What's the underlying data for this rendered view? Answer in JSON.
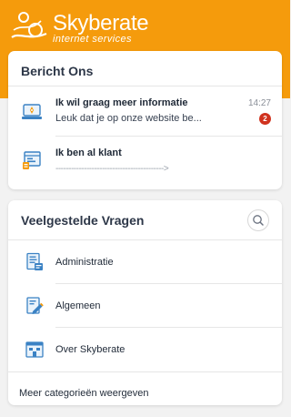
{
  "brand": {
    "name": "Skyberate",
    "tagline": "internet services",
    "color": "#f59b0c"
  },
  "contact": {
    "title": "Bericht Ons",
    "messages": [
      {
        "title": "Ik wil graag meer informatie",
        "preview": "Leuk dat je op onze website be...",
        "time": "14:27",
        "unread": "2",
        "icon": "laptop-chat-icon"
      },
      {
        "title": "Ik ben al klant",
        "preview": "------------------------------------------>",
        "icon": "window-dashboard-icon"
      }
    ]
  },
  "faq": {
    "title": "Veelgestelde Vragen",
    "search_icon": "search-icon",
    "categories": [
      {
        "label": "Administratie",
        "icon": "invoice-document-icon"
      },
      {
        "label": "Algemeen",
        "icon": "pencil-document-icon"
      },
      {
        "label": "Over Skyberate",
        "icon": "company-building-icon"
      }
    ],
    "more_label": "Meer categorieën weergeven"
  },
  "colors": {
    "badge": "#d0321e",
    "icon_blue": "#3b82c4",
    "icon_orange": "#f59b0c"
  }
}
